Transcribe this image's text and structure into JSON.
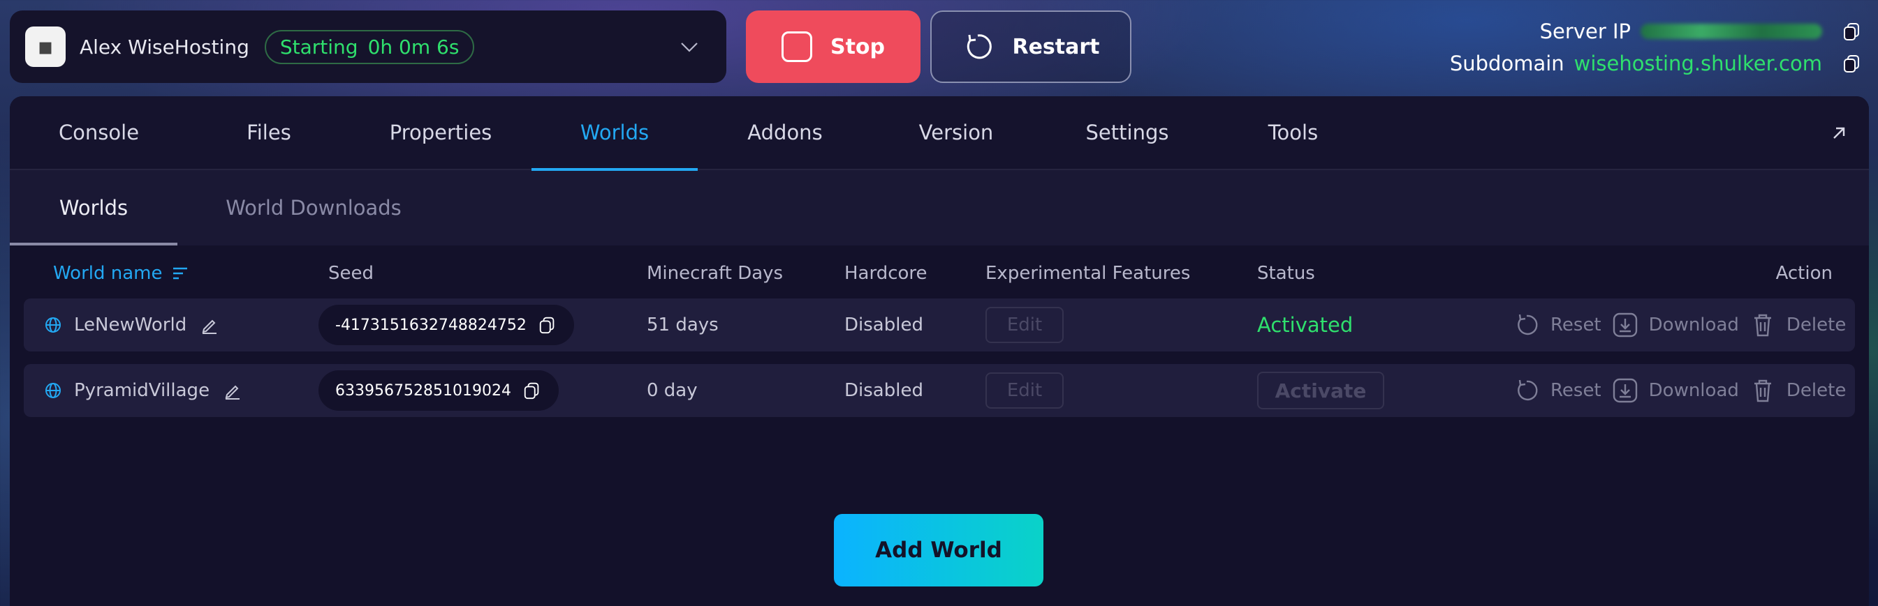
{
  "header": {
    "server_name": "Alex WiseHosting",
    "status": {
      "label": "Starting",
      "uptime": "0h 0m 6s",
      "color": "#2fe06d"
    },
    "stop_label": "Stop",
    "restart_label": "Restart",
    "server_ip_label": "Server IP",
    "subdomain_label": "Subdomain",
    "subdomain_value": "wisehosting.shulker.com"
  },
  "tabs": [
    "Console",
    "Files",
    "Properties",
    "Worlds",
    "Addons",
    "Version",
    "Settings",
    "Tools"
  ],
  "active_tab": "Worlds",
  "subtabs": [
    "Worlds",
    "World Downloads"
  ],
  "table": {
    "headers": {
      "world_name": "World name",
      "seed": "Seed",
      "days": "Minecraft Days",
      "hardcore": "Hardcore",
      "experimental": "Experimental Features",
      "status": "Status",
      "action": "Action"
    },
    "rows": [
      {
        "name": "LeNewWorld",
        "seed": "-4173151632748824752",
        "days": "51 days",
        "hardcore": "Disabled",
        "experimental": "Edit",
        "status": "Activated"
      },
      {
        "name": "PyramidVillage",
        "seed": "633956752851019024",
        "days": "0 day",
        "hardcore": "Disabled",
        "experimental": "Edit",
        "status": "Activate"
      }
    ],
    "actions": {
      "reset": "Reset",
      "download": "Download",
      "delete": "Delete"
    }
  },
  "add_world_label": "Add World",
  "colors": {
    "accent": "#23a8f2",
    "stop": "#ef4b5c",
    "success": "#2fe06d"
  }
}
